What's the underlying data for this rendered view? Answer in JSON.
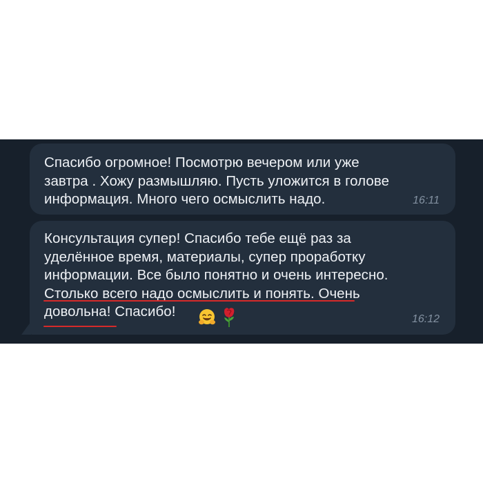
{
  "messages": [
    {
      "text": "Спасибо огромное! Посмотрю вечером или уже\nзавтра . Хожу размышляю. Пусть уложится в голове\nинформация. Много чего осмыслить надо.",
      "time": "16:11"
    },
    {
      "text": "Консультация супер! Спасибо тебе ещё раз за\nуделённое время, материалы, супер проработку\nинформации. Все было понятно и очень интересно.\nСтолько всего надо осмыслить и понять. Очень\nдовольна! Спасибо!",
      "time": "16:12",
      "emojis": [
        "hugging-face",
        "rose"
      ],
      "underlined_phrases": [
        "Столько всего надо осмыслить и понять.",
        "довольна!"
      ]
    }
  ],
  "colors": {
    "background": "#17202b",
    "bubble": "#232f3d",
    "text": "#eef1f5",
    "time": "#8391a1",
    "underline": "#d72a2a"
  }
}
